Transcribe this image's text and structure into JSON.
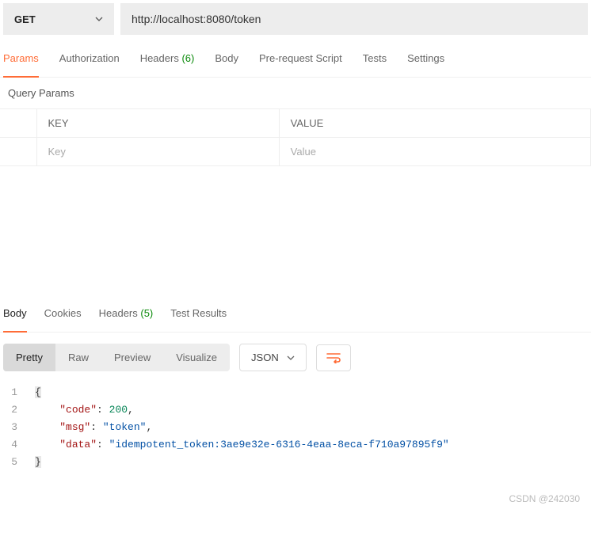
{
  "request": {
    "method": "GET",
    "url": "http://localhost:8080/token"
  },
  "tabs": {
    "params": "Params",
    "authorization": "Authorization",
    "headers_label": "Headers",
    "headers_count": "(6)",
    "body": "Body",
    "prerequest": "Pre-request Script",
    "tests": "Tests",
    "settings": "Settings"
  },
  "query_params": {
    "title": "Query Params",
    "key_header": "KEY",
    "value_header": "VALUE",
    "key_placeholder": "Key",
    "value_placeholder": "Value"
  },
  "response_tabs": {
    "body": "Body",
    "cookies": "Cookies",
    "headers_label": "Headers",
    "headers_count": "(5)",
    "test_results": "Test Results"
  },
  "view_modes": {
    "pretty": "Pretty",
    "raw": "Raw",
    "preview": "Preview",
    "visualize": "Visualize"
  },
  "lang": "JSON",
  "response_body": {
    "line1": "{",
    "line2_key": "\"code\"",
    "line2_val": "200",
    "line3_key": "\"msg\"",
    "line3_val": "\"token\"",
    "line4_key": "\"data\"",
    "line4_val": "\"idempotent_token:3ae9e32e-6316-4eaa-8eca-f710a97895f9\"",
    "line5": "}"
  },
  "ln": {
    "1": "1",
    "2": "2",
    "3": "3",
    "4": "4",
    "5": "5"
  },
  "watermark": "CSDN @242030"
}
